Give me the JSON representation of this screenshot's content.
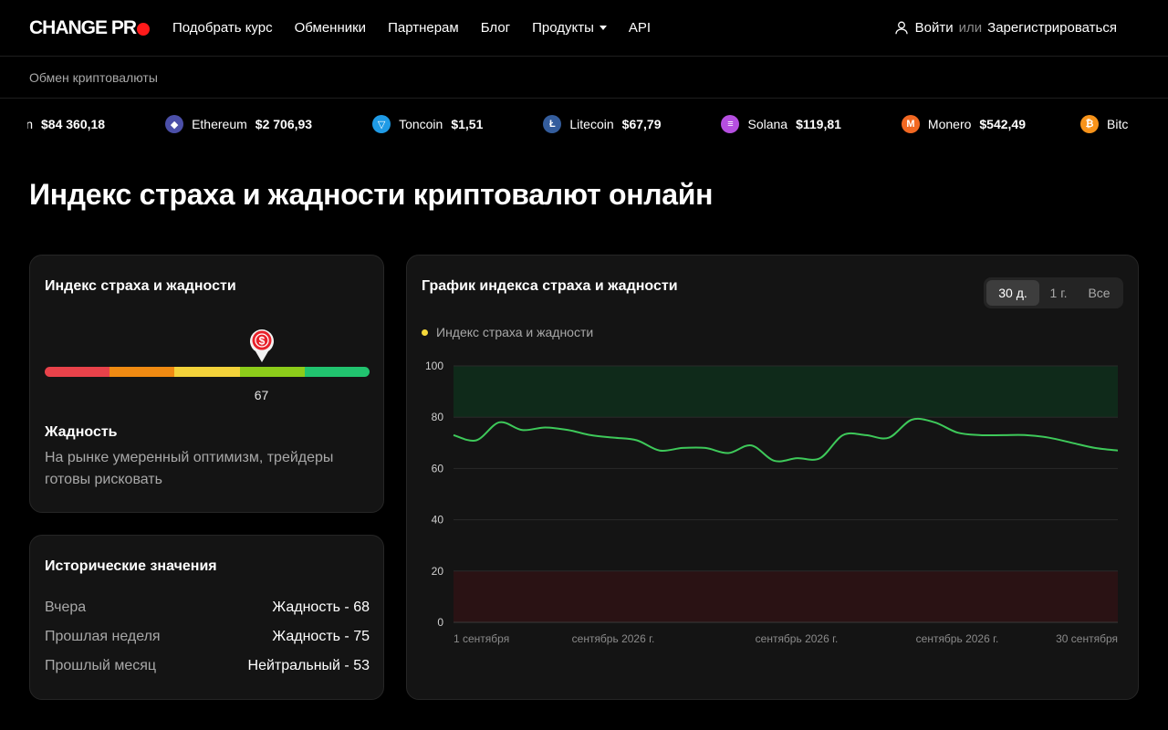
{
  "header": {
    "logo_text": "CHANGE PR",
    "nav": [
      "Подобрать курс",
      "Обменники",
      "Партнерам",
      "Блог",
      "Продукты",
      "API"
    ],
    "login": "Войти",
    "or": "или",
    "register": "Зарегистрироваться"
  },
  "breadcrumb": "Обмен криптовалюты",
  "ticker": [
    {
      "name": "",
      "price": "$84 360,18",
      "icon": "bitcoin-icon",
      "color": "#f7931a",
      "glyph": ""
    },
    {
      "name": "Ethereum",
      "price": "$2 706,93",
      "icon": "ethereum-icon",
      "color": "#4b4fa8",
      "glyph": "◆"
    },
    {
      "name": "Toncoin",
      "price": "$1,51",
      "icon": "toncoin-icon",
      "color": "#1f9be6",
      "glyph": "▽"
    },
    {
      "name": "Litecoin",
      "price": "$67,79",
      "icon": "litecoin-icon",
      "color": "#345d9d",
      "glyph": "Ł"
    },
    {
      "name": "Solana",
      "price": "$119,81",
      "icon": "solana-icon",
      "color": "#b54ee0",
      "glyph": "≡"
    },
    {
      "name": "Monero",
      "price": "$542,49",
      "icon": "monero-icon",
      "color": "#f26822",
      "glyph": "M"
    },
    {
      "name": "Bitc",
      "price": "",
      "icon": "bitcoin-icon",
      "color": "#f7931a",
      "glyph": "₿"
    }
  ],
  "page_title": "Индекс страха и жадности криптовалют онлайн",
  "gauge": {
    "title": "Индекс страха и жадности",
    "value": 67,
    "value_text": "67",
    "mood": "Жадность",
    "description": "На рынке умеренный оптимизм, трейдеры готовы рисковать",
    "segment_colors": [
      "#e8424a",
      "#ef8a12",
      "#f3d23a",
      "#8ccc1a",
      "#21c36f"
    ]
  },
  "history": {
    "title": "Исторические значения",
    "rows": [
      {
        "label": "Вчера",
        "value": "Жадность - 68"
      },
      {
        "label": "Прошлая неделя",
        "value": "Жадность - 75"
      },
      {
        "label": "Прошлый месяц",
        "value": "Нейтральный - 53"
      }
    ]
  },
  "chart_panel": {
    "title": "График индекса страха и жадности",
    "ranges": [
      "30 д.",
      "1 г.",
      "Все"
    ],
    "active_range": "30 д.",
    "legend": "Индекс страха и жадности"
  },
  "chart_data": {
    "type": "line",
    "series": [
      {
        "name": "Индекс страха и жадности",
        "color": "#3ec95a",
        "values": [
          73,
          71,
          78,
          75,
          76,
          75,
          73,
          72,
          71,
          67,
          68,
          68,
          66,
          69,
          63,
          64,
          64,
          73,
          73,
          72,
          79,
          78,
          74,
          73,
          73,
          73,
          72,
          70,
          68,
          67
        ]
      }
    ],
    "ylim": [
      0,
      100
    ],
    "yticks": [
      0,
      20,
      40,
      60,
      80,
      100
    ],
    "xtick_labels": [
      "1 сентября",
      "сентябрь 2026 г.",
      "сентябрь 2026 г.",
      "сентябрь 2026 г.",
      "30 сентября"
    ],
    "bands": [
      {
        "from": 80,
        "to": 100,
        "color": "#0f2a1a"
      },
      {
        "from": 0,
        "to": 20,
        "color": "#2a1214"
      }
    ],
    "grid": true
  }
}
